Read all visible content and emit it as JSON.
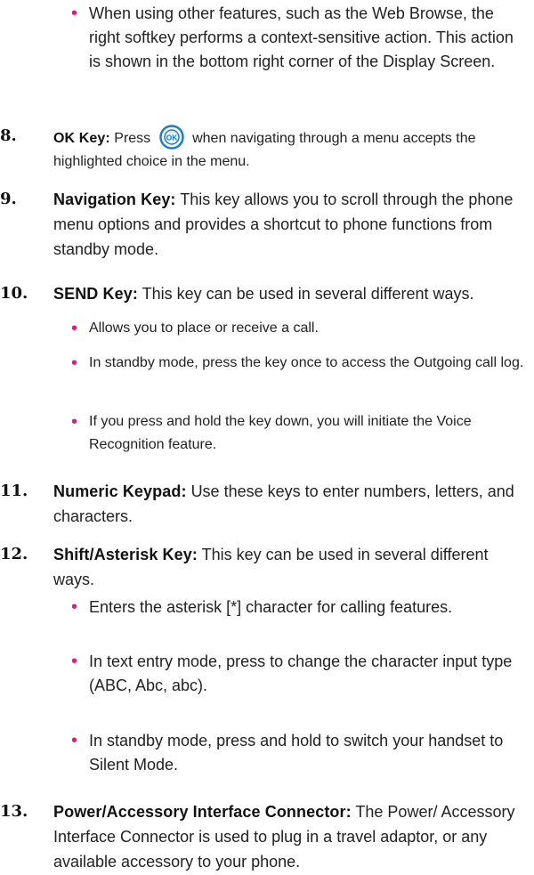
{
  "intro_bullet": "When using other features, such as the Web Browse, the right softkey performs a context-sensitive action. This action is shown in the bottom right corner of the Display Screen.",
  "items": [
    {
      "num": "8.",
      "term": "OK Key:",
      "pre": "Press",
      "post": "when navigating through a menu accepts the highlighted choice in the menu."
    },
    {
      "num": "9.",
      "term": "Navigation Key:",
      "text": "This key allows you to scroll through the phone menu options and provides a shortcut to phone functions from standby mode."
    },
    {
      "num": "10.",
      "term": "SEND Key:",
      "text": "This key can be used in several different ways.",
      "bullets": [
        "Allows you to place or receive a call.",
        "In standby mode, press the key once to access the Outgoing call log.",
        "If you press and hold the key down, you will initiate the Voice Recognition feature."
      ]
    },
    {
      "num": "11.",
      "term": "Numeric Keypad:",
      "text": "Use these keys to enter numbers, letters, and characters."
    },
    {
      "num": "12.",
      "term": "Shift/Asterisk Key:",
      "text": "This key can be used in several different ways.",
      "bullets": [
        "Enters the asterisk [*] character for calling features.",
        "In text entry mode, press to change the character input type (ABC, Abc, abc).",
        "In standby mode, press and hold to switch your handset to Silent Mode."
      ]
    },
    {
      "num": "13.",
      "term": "Power/Accessory Interface Connector:",
      "text": "The Power/ Accessory Interface Connector is used to plug in a travel adaptor, or any available accessory to your phone."
    }
  ],
  "colors": {
    "bullet": "#e8148c",
    "ok_icon_ring": "#1e7fc8"
  }
}
